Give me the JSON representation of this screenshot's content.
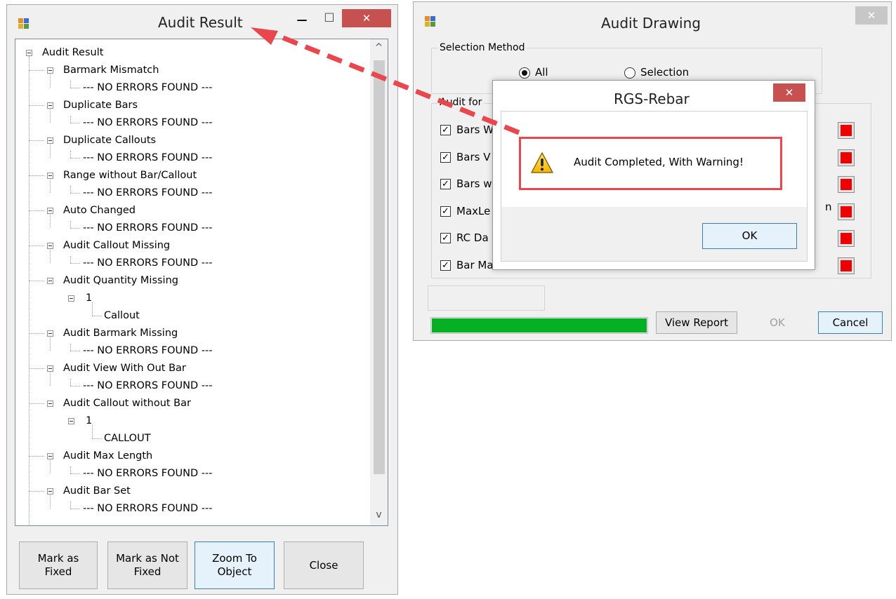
{
  "audit_result": {
    "title": "Audit Result",
    "tree": {
      "root": "Audit Result",
      "groups": [
        {
          "label": "Barmark Mismatch",
          "child": "--- NO ERRORS FOUND ---"
        },
        {
          "label": "Duplicate Bars",
          "child": "--- NO ERRORS FOUND ---"
        },
        {
          "label": "Duplicate Callouts",
          "child": "--- NO ERRORS FOUND ---"
        },
        {
          "label": "Range without Bar/Callout",
          "child": "--- NO ERRORS FOUND ---"
        },
        {
          "label": "Auto Changed",
          "child": "--- NO ERRORS FOUND ---"
        },
        {
          "label": "Audit Callout Missing",
          "child": "--- NO ERRORS FOUND ---"
        },
        {
          "label": "Audit Quantity Missing",
          "sub": "1",
          "subchild": "Callout"
        },
        {
          "label": "Audit Barmark Missing",
          "child": "--- NO ERRORS FOUND ---"
        },
        {
          "label": "Audit View With Out Bar",
          "child": "--- NO ERRORS FOUND ---"
        },
        {
          "label": "Audit Callout without Bar",
          "sub": "1",
          "subchild": "CALLOUT"
        },
        {
          "label": "Audit Max Length",
          "child": "--- NO ERRORS FOUND ---"
        },
        {
          "label": "Audit Bar Set",
          "child": "--- NO ERRORS FOUND ---"
        }
      ]
    },
    "buttons": {
      "mark_fixed": "Mark as Fixed",
      "mark_not_fixed": "Mark as Not Fixed",
      "zoom": "Zoom To Object",
      "close": "Close"
    }
  },
  "audit_drawing": {
    "title": "Audit Drawing",
    "selection_method": {
      "legend": "Selection Method",
      "options": [
        "All",
        "Selection"
      ],
      "selected": "All"
    },
    "audit_for": {
      "legend": "Audit for",
      "items": [
        {
          "label": "Bars W",
          "checked": true
        },
        {
          "label": "Bars V",
          "checked": true
        },
        {
          "label": "Bars w",
          "checked": true
        },
        {
          "label": "MaxLe",
          "checked": true
        },
        {
          "label": "RC Da",
          "checked": true
        },
        {
          "label": "Bar Ma",
          "checked": true
        }
      ],
      "peek_text": "n",
      "status_color": "#ee0000"
    },
    "progress": 1.0,
    "progress_color": "#06b025",
    "buttons": {
      "view_report": "View Report",
      "ok": "OK",
      "cancel": "Cancel"
    }
  },
  "message_box": {
    "title": "RGS-Rebar",
    "message": "Audit Completed, With Warning!",
    "ok": "OK",
    "icon": "warning-icon",
    "highlight_color": "#e8474e"
  },
  "annotation": {
    "arrow_color": "#e8474e"
  },
  "glyphs": {
    "close": "✕",
    "check": "✓",
    "minimize": "—",
    "maximize": "☐",
    "scroll_up": "^",
    "scroll_down": "v"
  }
}
